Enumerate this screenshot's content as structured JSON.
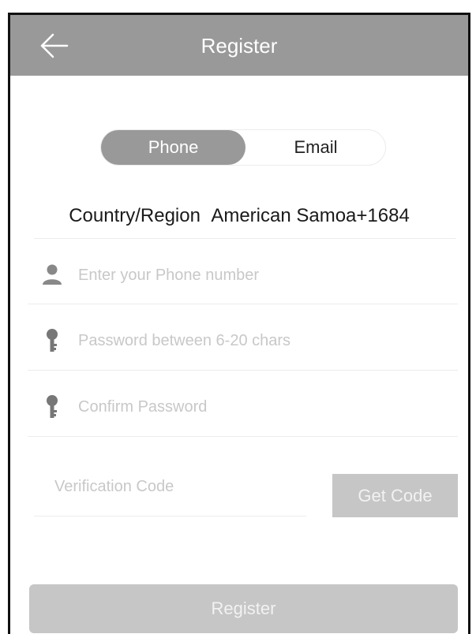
{
  "header": {
    "title": "Register",
    "back_icon": "arrow-left-icon"
  },
  "tabs": {
    "phone_label": "Phone",
    "email_label": "Email",
    "selected": "Phone"
  },
  "country": {
    "label": "Country/Region",
    "value": "American Samoa+1684"
  },
  "fields": {
    "phone": {
      "placeholder": "Enter your Phone number",
      "icon": "user-icon",
      "value": ""
    },
    "password": {
      "placeholder": "Password between 6-20 chars",
      "icon": "key-icon",
      "value": ""
    },
    "confirm_password": {
      "placeholder": "Confirm Password",
      "icon": "key-icon",
      "value": ""
    },
    "verification_code": {
      "placeholder": "Verification Code",
      "value": ""
    }
  },
  "buttons": {
    "get_code_label": "Get Code",
    "register_label": "Register"
  },
  "colors": {
    "header_bg": "#999999",
    "active_tab_bg": "#999999",
    "disabled_button_bg": "#c6c6c6",
    "placeholder": "#c8c8c8"
  }
}
